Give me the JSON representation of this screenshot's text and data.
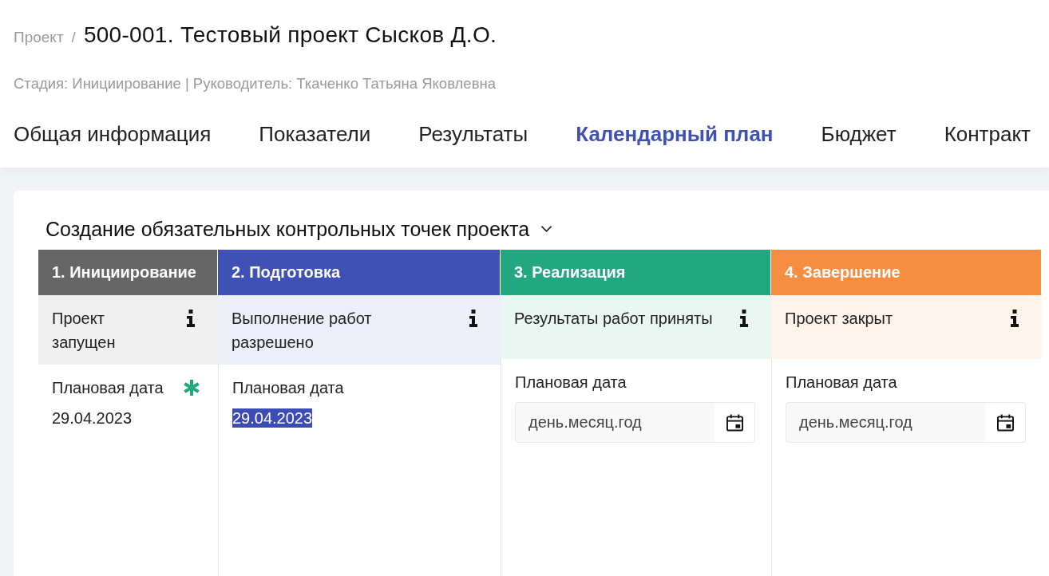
{
  "breadcrumb": {
    "parent": "Проект",
    "separator": "/",
    "title": "500-001. Тестовый проект Сысков Д.О."
  },
  "subtitle": "Стадия: Инициирование | Руководитель: Ткаченко Татьяна Яковлевна",
  "tabs": [
    {
      "label": "Общая информация",
      "selected": false
    },
    {
      "label": "Показатели",
      "selected": false
    },
    {
      "label": "Результаты",
      "selected": false
    },
    {
      "label": "Календарный план",
      "selected": true
    },
    {
      "label": "Бюджет",
      "selected": false
    },
    {
      "label": "Контракт",
      "selected": false
    }
  ],
  "section": {
    "title": "Создание обязательных контрольных точек проекта",
    "stages": [
      {
        "title": "1. Инициирование",
        "color": "#666666",
        "milestone": "Проект запущен",
        "date_label": "Плановая дата",
        "required": true,
        "kind": "text",
        "date": "29.04.2023",
        "highlighted": false
      },
      {
        "title": "2. Подготовка",
        "color": "#3f51b5",
        "milestone": "Выполнение работ разрешено",
        "date_label": "Плановая дата",
        "required": false,
        "kind": "text",
        "date": "29.04.2023",
        "highlighted": true
      },
      {
        "title": "3. Реализация",
        "color": "#23a77e",
        "milestone": "Результаты работ приняты",
        "date_label": "Плановая дата",
        "required": false,
        "kind": "input",
        "placeholder": "день.месяц.год"
      },
      {
        "title": "4. Завершение",
        "color": "#f78d40",
        "milestone": "Проект закрыт",
        "date_label": "Плановая дата",
        "required": false,
        "kind": "input",
        "placeholder": "день.месяц.год"
      }
    ]
  }
}
